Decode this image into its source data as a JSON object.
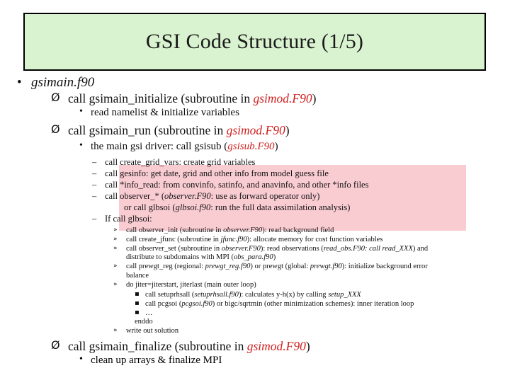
{
  "slide": {
    "title": "GSI Code Structure (1/5)",
    "root_bullet": "gsimain.f90",
    "sections": [
      {
        "marker": "Ø",
        "text_pre": "call gsimain_initialize (subroutine in ",
        "code": "gsimod.F90",
        "text_post": ")"
      }
    ],
    "l2_read_namelist": "read namelist & initialize variables",
    "gsimain_run": {
      "text_pre": "call gsimain_run (subroutine in ",
      "code": "gsimod.F90",
      "text_post": ")"
    },
    "main_driver": {
      "text_pre": "the main gsi driver: call gsisub (",
      "code": "gsisub.F90",
      "text_post": ")"
    },
    "dash_items": [
      "call create_grid_vars: create grid variables",
      "call gesinfo: get date, grid and other info from model guess file",
      "call *info_read: from convinfo, satinfo, and anavinfo, and other *info files"
    ],
    "observer_line": {
      "pre": "call observer_* (",
      "code": "observer.F90",
      "post": ": use as forward operator only)"
    },
    "glbsoi_line": {
      "pre": "or call glbsoi (",
      "code": "glbsoi.f90",
      "post": ": run the full data assimilation analysis)"
    },
    "if_call": "If call glbsoi:",
    "sub_items": [
      {
        "pre": "call observer_init (subroutine in ",
        "code": "observer.F90",
        "post": "): read background field"
      },
      {
        "pre": "call create_jfunc (subroutine in ",
        "code": "jfunc.f90",
        "post": "): allocate memory for cost function variables"
      },
      {
        "pre": "call observer_set (subroutine in ",
        "code": "observer.F90",
        "post": "): read observations (",
        "code2": "read_obs.F90: call read_XXX",
        "post2": ") and"
      },
      {
        "pre": "call prewgt_reg (regional: ",
        "code": "prewgt_reg.f90",
        "post": ") or prewgt (global: ",
        "code2": "prewgt.f90",
        "post2": "): initialize background error"
      },
      {
        "pre": "do jiter=jiterstart, jiterlast (main outer loop)"
      }
    ],
    "sub_item3_cont": "distribute to subdomains with MPI (",
    "sub_item3_cont_code": "obs_para.f90",
    "sub_item3_cont_post": ")",
    "sub_item4_cont": "balance",
    "inner_items": [
      {
        "pre": "call setuprhsall (",
        "code": "setuprhsall.f90",
        "post": "): calculates y-h(x) by calling ",
        "code2": "setup_XXX"
      },
      {
        "pre": "call pcgsoi (",
        "code": "pcgsoi.f90",
        "post": ") or bigc/sqrtmin (other minimization schemes): inner iteration loop"
      },
      {
        "pre": "…"
      }
    ],
    "enddo": "enddo",
    "write_out": "write out solution",
    "finalize": {
      "pre": "call gsimain_finalize (subroutine in ",
      "code": "gsimod.F90",
      "post": ")"
    },
    "last_line": "clean up arrays & finalize MPI",
    "bullets": {
      "diamond": "Ø",
      "dot": "•",
      "dash": "–",
      "raquo": "»",
      "square": "▪"
    }
  }
}
